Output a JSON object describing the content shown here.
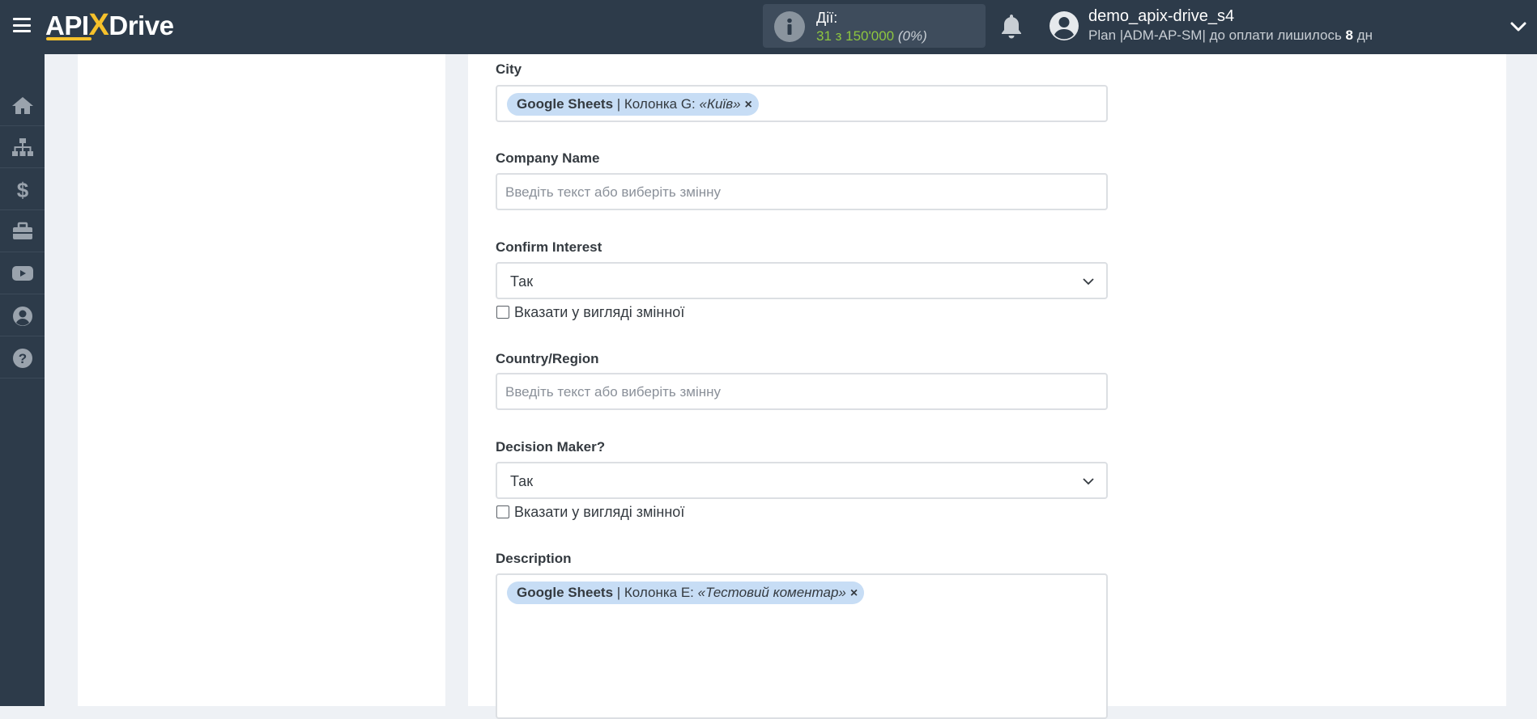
{
  "header": {
    "logo_prefix": "API",
    "logo_x": "X",
    "logo_suffix": "Drive",
    "actions_label": "Дії:",
    "actions_count": "31 з 150'000",
    "actions_percent": "(0%)",
    "user_name": "demo_apix-drive_s4",
    "plan_text": "Plan |ADM-AP-SM| до оплати лишилось ",
    "plan_days": "8",
    "plan_days_unit": " дн",
    "icons": [
      "menu-icon",
      "info-icon",
      "bell-icon",
      "user-avatar-icon",
      "chevron-down-icon"
    ]
  },
  "sidebar": {
    "items": [
      {
        "icon": "home-icon"
      },
      {
        "icon": "sitemap-icon"
      },
      {
        "icon": "dollar-icon"
      },
      {
        "icon": "briefcase-icon"
      },
      {
        "icon": "youtube-icon"
      },
      {
        "icon": "user-circle-icon"
      },
      {
        "icon": "help-icon"
      }
    ]
  },
  "form": {
    "city": {
      "label": "City",
      "tag": {
        "source": "Google Sheets",
        "column": " | Колонка G: ",
        "value": "«Київ»",
        "remove": "×"
      }
    },
    "company_name": {
      "label": "Company Name",
      "placeholder": "Введіть текст або виберіть змінну"
    },
    "confirm_interest": {
      "label": "Confirm Interest",
      "value": "Так",
      "checkbox_label": "Вказати у вигляді змінної"
    },
    "country_region": {
      "label": "Country/Region",
      "placeholder": "Введіть текст або виберіть змінну"
    },
    "decision_maker": {
      "label": "Decision Maker?",
      "value": "Так",
      "checkbox_label": "Вказати у вигляді змінної"
    },
    "description": {
      "label": "Description",
      "tag": {
        "source": "Google Sheets",
        "column": " | Колонка E: ",
        "value": "«Тестовий коментар»",
        "remove": "×"
      }
    }
  },
  "colors": {
    "header_bg": "#2d3b4a",
    "accent_yellow": "#f6c12b",
    "actions_green": "#8ec63f",
    "tag_bg": "#c7ddf5"
  }
}
